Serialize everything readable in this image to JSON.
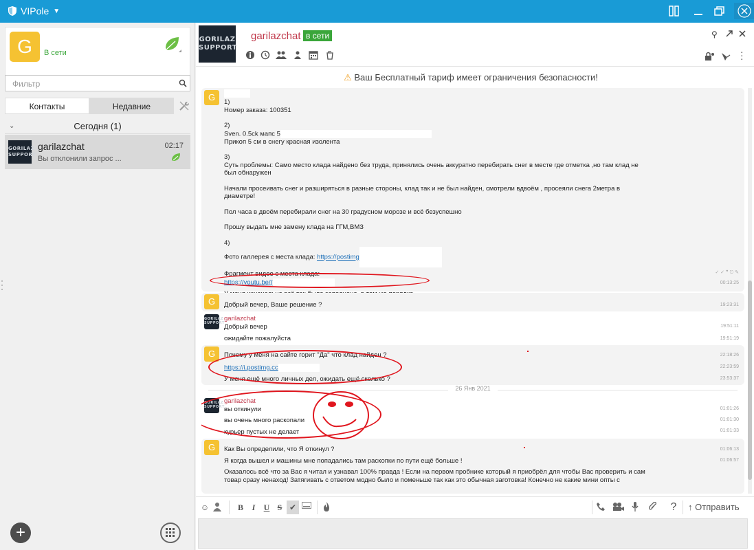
{
  "app": {
    "title": "VIPole"
  },
  "profile": {
    "status": "В сети",
    "avatar_letter": "G"
  },
  "search": {
    "placeholder": "Фильтр"
  },
  "tabs": {
    "contacts": "Контакты",
    "recent": "Недавние"
  },
  "group": {
    "label": "Сегодня (1)"
  },
  "contact": {
    "name": "garilazchat",
    "time": "02:17",
    "preview": "Вы отклонили запрос ...",
    "logo": "GORILAZ SUPPORT"
  },
  "chat": {
    "name": "garilazchat",
    "status": "в сети",
    "logo": "GORILAZ SUPPORT"
  },
  "warning": "Ваш Бесплатный тариф имеет ограничения безопасности!",
  "messages": {
    "m1": {
      "l1": "1)",
      "l2": "Номер заказа: 100351",
      "l3": "2)",
      "l4": "Sven. 0.5ck мапс 5",
      "l5": "Прикоп 5 см в снегу красная изолента",
      "l6": "3)",
      "l7": "Суть проблемы: Само место клада найдено без труда, принялись  очень аккуратно перебирать снег в месте где отметка ,но там клад не",
      "l8": "был обнаружен",
      "l9": "Начали просеивать снег и разширяться в разные стороны, клад так и не был найден, смотрели вдвоём , просеяли снега 2метра в",
      "l10": "диаметре!",
      "l11": "Пол часа в двоём перебирали снег на 30 градусном морозе и всё безуспешно",
      "l12": "Прошу выдать мне замену клада на ГГМ,ВМЗ",
      "l13": "4)",
      "l14": "Фото галлерея с места клада: ",
      "l14_link": "https://postimg",
      "l15": "Фрагмент видео с места клада:",
      "l16_link": "https://youtu.be/(",
      "l17": "У меня изначально всё так было заполнено, в том же порядке",
      "t17": "00:13:25"
    },
    "m2": {
      "text": "Добрый вечер, Ваше решение ?",
      "time": "19:23:31"
    },
    "m3": {
      "sender": "garilazchat",
      "l1": "Добрый вечер",
      "t1": "19:51:11",
      "l2": "ожидайте пожалуйста",
      "t2": "19:51:19"
    },
    "m4": {
      "l1": "Почему у меня на сайте горит \"Да\" что клад найден ?",
      "t1": "22:18:26",
      "l2_link": "https://i.postimg.cc",
      "t2": "22:23:59",
      "l3": "У меня ещё много личных дел, ожидать ещё сколько ?",
      "t3": "23:53:37"
    },
    "date_sep": "26 Янв 2021",
    "m5": {
      "sender": "garilazchat",
      "l1": "вы откинули",
      "t1": "01:01:26",
      "l2": "вы очень много раскопали",
      "t2": "01:01:30",
      "l3": "курьер пустых не делает",
      "t3": "01:01:33"
    },
    "m6": {
      "l1": "Как Вы определили, что Я откинул ?",
      "t1": "01:06:13",
      "l2": "Я когда вышел и машины мне попадались там раскопки по пути ещё больше !",
      "t2": "01:06:57",
      "l3": "Оказалось всё что за Вас я читал и узнавал 100% правда ! Если на первом пробнике который я приобрёл для чтобы Вас проверить и сам",
      "l4": "товар  сразу ненаход!  Затягивать с ответом модно было и поменьше  так как это обычная заготовка! Конечно не какие мини опты с"
    }
  },
  "toolbar": {
    "bold": "B",
    "italic": "I",
    "underline": "U",
    "strike": "S",
    "send": "Отправить"
  },
  "colors": {
    "accent": "#199bd6",
    "online": "#3aa63a",
    "link": "#1c6fb8",
    "sender": "#c0394b",
    "annotation": "#e0161e"
  }
}
